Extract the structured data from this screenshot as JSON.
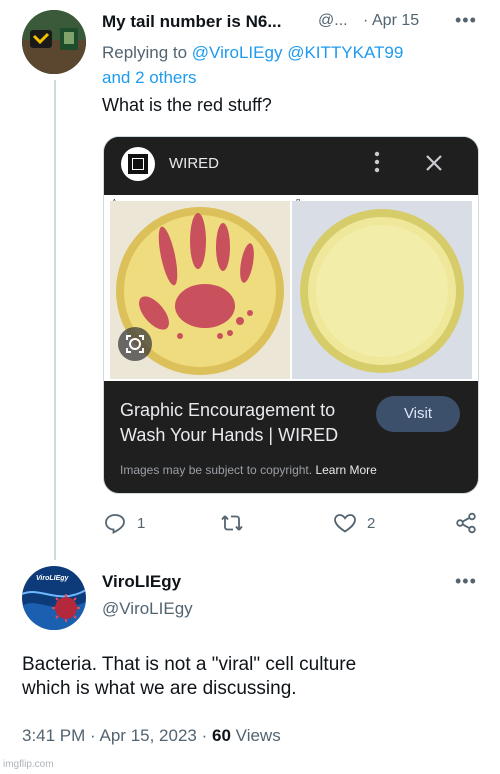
{
  "reply_tweet": {
    "author_name": "My tail number is N6...",
    "author_handle": "@...",
    "separator": "·",
    "date": "Apr 15",
    "more_label": "•••",
    "replying_to_prefix": "Replying to",
    "replying_to_users": [
      "@ViroLIEgy",
      "@KITTYKAT99"
    ],
    "replying_to_others": "and 2 others",
    "text": "What is the red stuff?",
    "card": {
      "source_name": "WIRED",
      "panel_a_label": "A",
      "panel_b_label": "B",
      "title_line1": "Graphic Encouragement to",
      "title_line2": "Wash Your Hands | WIRED",
      "visit_label": "Visit",
      "copyright_text": "Images may be subject to copyright.",
      "learn_more_label": "Learn More"
    },
    "actions": {
      "reply_count": "1",
      "retweet_count": "",
      "like_count": "2"
    }
  },
  "main_tweet": {
    "author_name": "ViroLIEgy",
    "author_handle": "@ViroLIEgy",
    "more_label": "•••",
    "avatar_text": "ViroLIEgy",
    "text_line1": "Bacteria. That is not a \"viral\" cell culture",
    "text_line2": "which is what we are discussing.",
    "time": "3:41 PM",
    "separator": "·",
    "date": "Apr 15, 2023",
    "separator2": "·",
    "views_count": "60",
    "views_label": "Views"
  },
  "watermark": "imgflip.com",
  "colors": {
    "link": "#1d9bf0",
    "muted": "#536471",
    "card_dark": "#1f1f1f",
    "visit_button": "#3c4f6b"
  }
}
